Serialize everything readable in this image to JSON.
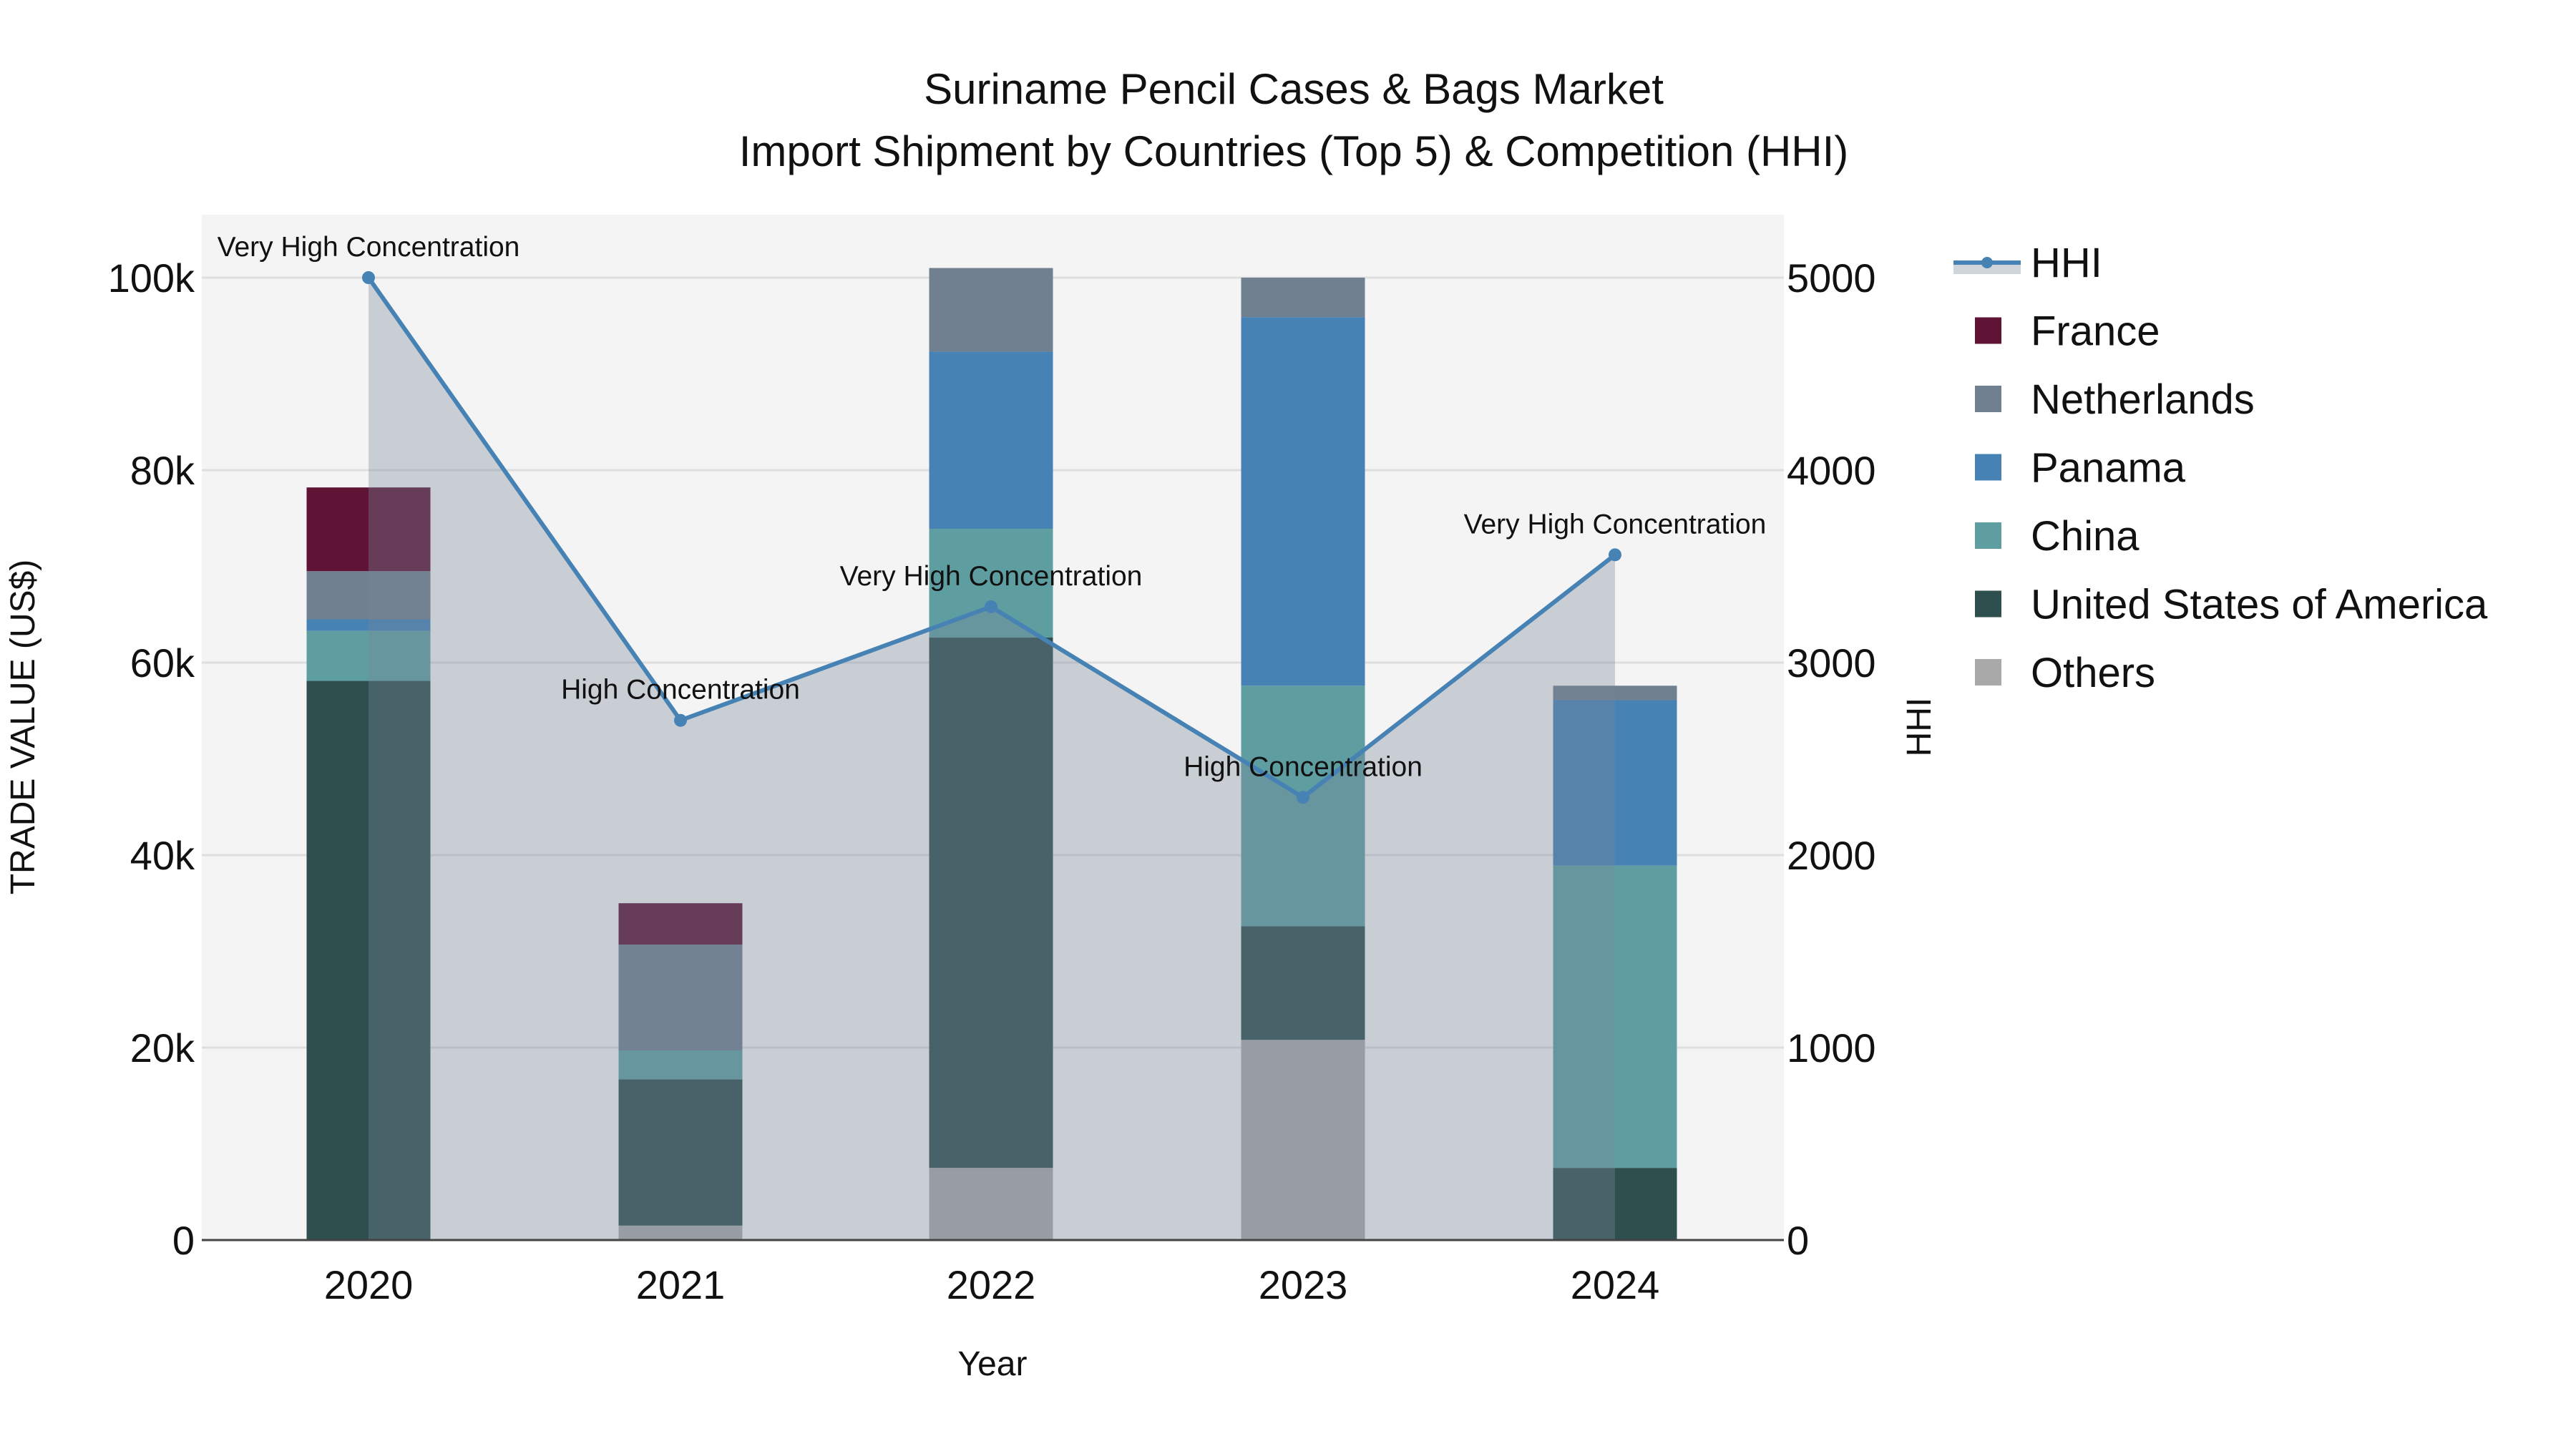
{
  "chart_data": {
    "type": "bar",
    "title_line1": "Suriname Pencil Cases & Bags Market",
    "title_line2": "Import Shipment by Countries (Top 5) & Competition (HHI)",
    "xlabel": "Year",
    "ylabel": "TRADE VALUE (US$)",
    "y2label": "HHI",
    "categories": [
      "2020",
      "2021",
      "2022",
      "2023",
      "2024"
    ],
    "ylim": [
      0,
      106000
    ],
    "y2lim": [
      0,
      5300
    ],
    "yticks": [
      0,
      20000,
      40000,
      60000,
      80000,
      100000
    ],
    "ytick_labels": [
      "0",
      "20k",
      "40k",
      "60k",
      "80k",
      "100k"
    ],
    "y2ticks": [
      0,
      1000,
      2000,
      3000,
      4000,
      5000
    ],
    "y2tick_labels": [
      "0",
      "1000",
      "2000",
      "3000",
      "4000",
      "5000"
    ],
    "grid": true,
    "legend_position": "right",
    "stack_order": [
      "Others",
      "United States of America",
      "China",
      "Panama",
      "Netherlands",
      "France"
    ],
    "series": [
      {
        "name": "France",
        "color": "#5f1436",
        "values": [
          8700,
          4300,
          0,
          0,
          0
        ]
      },
      {
        "name": "Netherlands",
        "color": "#708090",
        "values": [
          5000,
          11000,
          8700,
          4100,
          1500
        ]
      },
      {
        "name": "Panama",
        "color": "#4682b4",
        "values": [
          1200,
          0,
          18400,
          38300,
          17200
        ]
      },
      {
        "name": "China",
        "color": "#5f9ea0",
        "values": [
          5200,
          3000,
          11300,
          25000,
          31400
        ]
      },
      {
        "name": "United States of America",
        "color": "#2f4f4f",
        "values": [
          58100,
          15200,
          55100,
          11800,
          7500
        ]
      },
      {
        "name": "Others",
        "color": "#a9a9a9",
        "values": [
          0,
          1500,
          7500,
          20800,
          0
        ]
      }
    ],
    "hhi": {
      "name": "HHI",
      "color": "#4682b4",
      "values": [
        5000,
        2700,
        3290,
        2300,
        3560
      ],
      "annotations": [
        "Very High Concentration",
        "High Concentration",
        "Very High Concentration",
        "High Concentration",
        "Very High Concentration"
      ]
    }
  }
}
